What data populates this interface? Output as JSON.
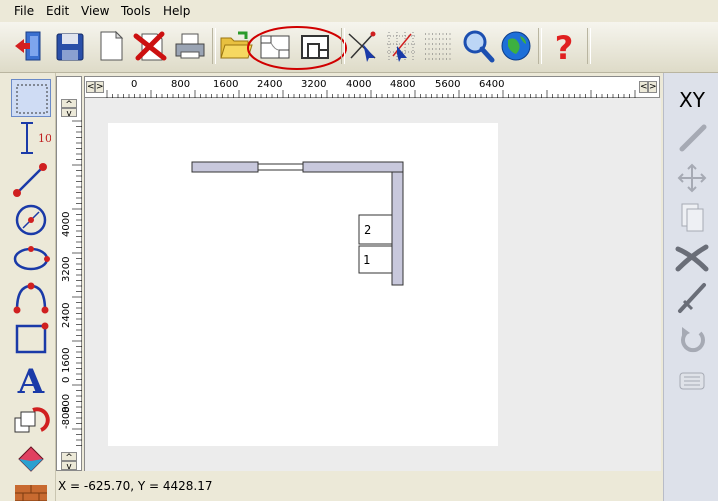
{
  "menu": {
    "file": "File",
    "edit": "Edit",
    "view": "View",
    "tools": "Tools",
    "help": "Help"
  },
  "toolbar": {
    "icons": [
      "exit-icon",
      "save-icon",
      "new-document-icon",
      "delete-drawing-icon",
      "print-icon",
      "open-folder-icon",
      "room-view-icon",
      "floor-plan-icon",
      "select-arrow-icon",
      "grid-snap-icon",
      "dot-grid-icon",
      "zoom-icon",
      "globe-icon",
      "help-icon"
    ],
    "help_glyph": "?"
  },
  "ruler": {
    "h_labels": [
      "0",
      "800",
      "1600",
      "2400",
      "3200",
      "4000",
      "4800",
      "5600",
      "6400"
    ],
    "v_labels": [
      "4000",
      "3200",
      "2400",
      "1600",
      "800",
      "0",
      "-800"
    ],
    "left_arrow": "<",
    "right_arrow": ">",
    "up_arrow": "^",
    "down_arrow": "v"
  },
  "tools": {
    "dimension_label": "10",
    "text_tool_glyph": "A"
  },
  "right_tools": {
    "xy_label": "XY"
  },
  "drawing": {
    "cabinet_1_label": "1",
    "cabinet_2_label": "2"
  },
  "status": {
    "coordinates": "X = -625.70, Y = 4428.17"
  },
  "colors": {
    "wall_fill": "#c8c8dc",
    "highlight_circle": "#d00000",
    "accent_red": "#cc2020"
  }
}
